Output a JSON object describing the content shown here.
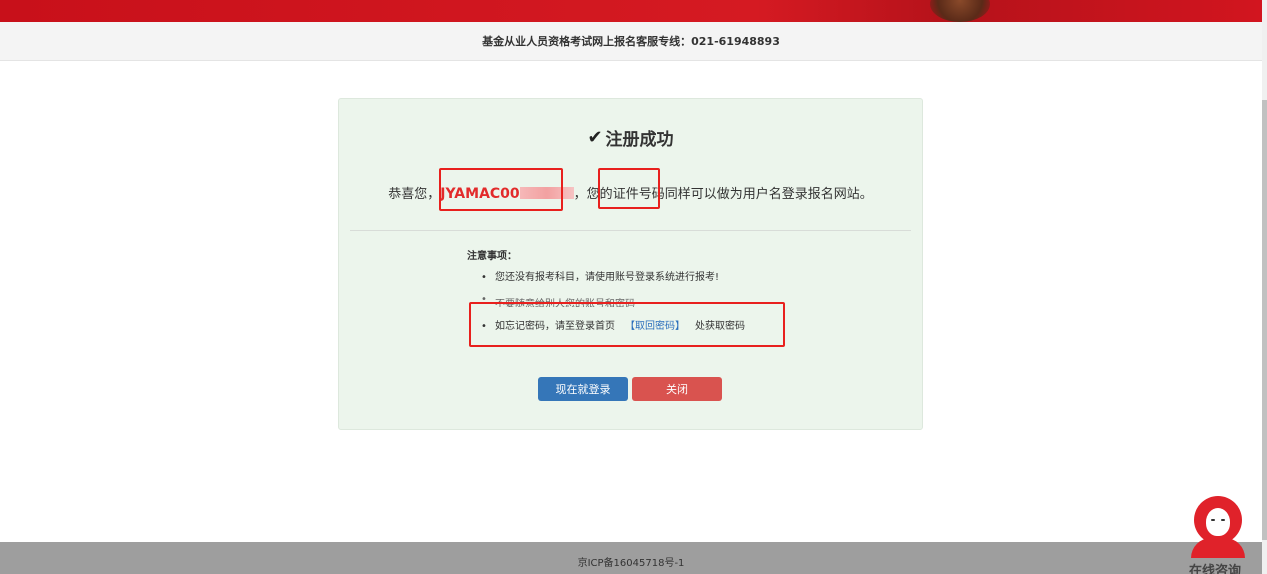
{
  "header": {
    "hotline": "基金从业人员资格考试网上报名客服专线：021-61948893"
  },
  "panel": {
    "title": "注册成功",
    "congrats_prefix": "恭喜您，",
    "account_id_visible": "JYAMAC00",
    "congrats_middle": "，您的",
    "cert_label": "证件号码",
    "congrats_suffix": "同样可以做为用户名登录报名网站。"
  },
  "notice": {
    "title": "注意事项：",
    "items": [
      "您还没有报考科目，请使用账号登录系统进行报考!",
      "不要随意给别人您的账号和密码"
    ],
    "retrieve_prefix": "如忘记密码，请至登录首页",
    "retrieve_link": "【取回密码】",
    "retrieve_suffix": "处获取密码"
  },
  "buttons": {
    "login": "现在就登录",
    "close": "关闭"
  },
  "footer": {
    "icp": "京ICP备16045718号-1"
  },
  "chat": {
    "label": "在线咨询"
  },
  "colors": {
    "brand_red": "#d51a22",
    "panel_bg": "#ecf5ec",
    "login_button": "#3576b8",
    "close_button": "#d9534f",
    "account_id": "#e22b2b",
    "annotation": "#e8201d"
  }
}
